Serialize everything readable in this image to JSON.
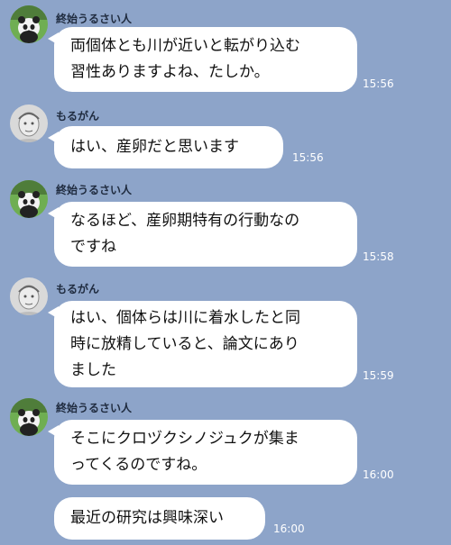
{
  "users": {
    "a": "終始うるさい人",
    "b": "もるがん"
  },
  "messages": [
    {
      "text": "両個体とも川が近いと転がり込む\n習性ありますよね、たしか。",
      "time": "15:56"
    },
    {
      "text": "はい、産卵だと思います",
      "time": "15:56"
    },
    {
      "text": "なるほど、産卵期特有の行動なの\nですね",
      "time": "15:58"
    },
    {
      "text": "はい、個体らは川に着水したと同\n時に放精していると、論文にあり\nました",
      "time": "15:59"
    },
    {
      "text": "そこにクロヅクシノジュクが集ま\nってくるのですね。",
      "time": "16:00"
    },
    {
      "text": "最近の研究は興味深い",
      "time": "16:00"
    }
  ],
  "icons": {
    "avatar_a": "panda-avatar-icon",
    "avatar_b": "sketch-portrait-avatar-icon"
  },
  "colors": {
    "background": "#8da4c9",
    "bubble": "#ffffff",
    "name_text": "#1f2b3f",
    "time_text": "#ffffff"
  }
}
